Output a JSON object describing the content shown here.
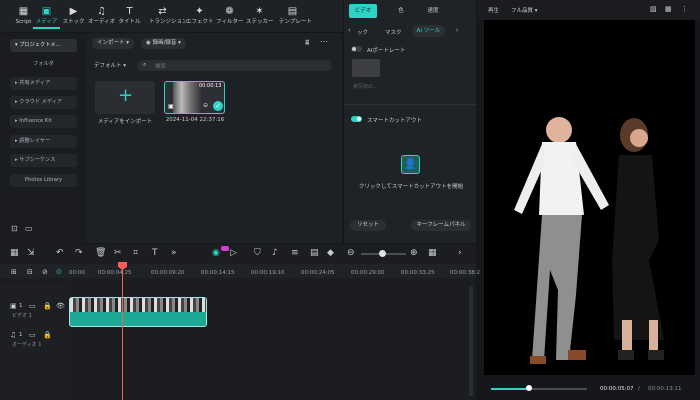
{
  "toolbar": {
    "items": [
      {
        "label": "Script",
        "icon": "script-icon"
      },
      {
        "label": "メディア",
        "icon": "media-icon"
      },
      {
        "label": "ストック",
        "icon": "stock-icon"
      },
      {
        "label": "オーディオ",
        "icon": "music-note-icon"
      },
      {
        "label": "タイトル",
        "icon": "text-t-icon"
      },
      {
        "label": "トランジション",
        "icon": "transition-icon"
      },
      {
        "label": "エフェクト",
        "icon": "sparkle-icon"
      },
      {
        "label": "フィルター",
        "icon": "filter-icon"
      },
      {
        "label": "ステッカー",
        "icon": "sticker-icon"
      },
      {
        "label": "テンプレート",
        "icon": "template-icon"
      }
    ]
  },
  "sidebar": {
    "items": [
      {
        "label": "プロジェクトメ…"
      },
      {
        "label": "フォルダ"
      },
      {
        "label": "共有メディア"
      },
      {
        "label": "クラウド メディア"
      },
      {
        "label": "Influence Kit"
      },
      {
        "label": "調整レイヤー"
      },
      {
        "label": "サブシーケンス"
      },
      {
        "label": "Photos Library"
      }
    ]
  },
  "media": {
    "import_label": "インポート",
    "record_label": "録画/録音",
    "sort_label": "デフォルト",
    "search_placeholder": "検索",
    "import_tile_label": "メディアをインポート",
    "clip_duration": "00:00:13",
    "clip_name": "2024-11-04 22:37:16"
  },
  "props": {
    "tabs": [
      "ビデオ",
      "色",
      "速度"
    ],
    "subtabs": [
      "ック",
      "マスク",
      "AI ツール"
    ],
    "ai_portrait_label": "AIポートレート",
    "disabled_hint": "被写体の…",
    "smart_cutout_label": "スマートカットアウト",
    "smart_cutout_start": "クリックしてスマートカットアウトを開始",
    "reset_label": "リセット",
    "keyframe_label": "キーフレームパネル"
  },
  "preview": {
    "mode_label": "再生",
    "quality_label": "フル品質",
    "current_time": "00:00:05:07",
    "total_time": "00:00:13:11",
    "progress": 0.39
  },
  "timeline": {
    "ruler": [
      "00:00",
      "00:00:04:25",
      "00:00:09:20",
      "00:00:14:15",
      "00:00:19:10",
      "00:00:24:05",
      "00:00:29:00",
      "00:00:33:25",
      "00:00:38:2"
    ],
    "video_track_label": "ビデオ 1",
    "video_track_num": "1",
    "audio_track_label": "オーディオ 1",
    "audio_track_num": "1"
  },
  "colors": {
    "accent": "#2ed3c6",
    "playhead": "#ff5a5a",
    "clip": "#1ea896"
  }
}
